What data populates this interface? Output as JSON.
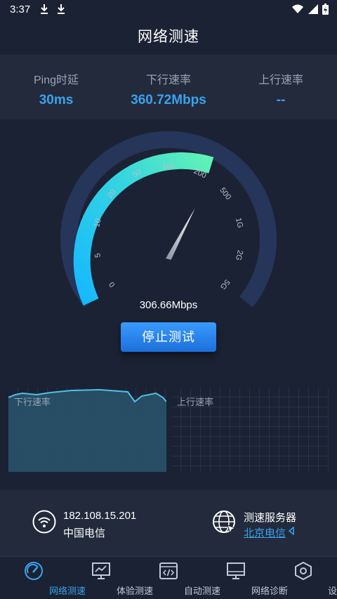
{
  "status_bar": {
    "time": "3:37"
  },
  "header": {
    "title": "网络测速"
  },
  "metrics": [
    {
      "label": "Ping时延",
      "value": "30ms"
    },
    {
      "label": "下行速率",
      "value": "360.72Mbps"
    },
    {
      "label": "上行速率",
      "value": "--"
    }
  ],
  "gauge": {
    "scale_labels": [
      "0",
      "5",
      "10",
      "20",
      "50",
      "100",
      "200",
      "500",
      "1G",
      "2G",
      "5G"
    ],
    "current_speed": "306.66Mbps"
  },
  "actions": {
    "stop_label": "停止测试"
  },
  "graphs": {
    "down_label": "下行速率",
    "up_label": "上行速率"
  },
  "network": {
    "ip": "182.108.15.201",
    "isp": "中国电信"
  },
  "server": {
    "title": "测速服务器",
    "name": "北京电信"
  },
  "nav": {
    "items": [
      {
        "label": "网络测速",
        "icon": "speedometer-icon",
        "active": true
      },
      {
        "label": "体验测速",
        "icon": "monitor-chart-icon"
      },
      {
        "label": "自动测速",
        "icon": "code-window-icon"
      },
      {
        "label": "网络诊断",
        "icon": "monitor-icon"
      },
      {
        "label": "设置",
        "icon": "hexagon-settings-icon"
      }
    ]
  },
  "colors": {
    "accent": "#3aa2ec",
    "background": "#1b2233",
    "panel": "#222a3b",
    "gauge_start": "#18c6ff",
    "gauge_end": "#5ef0b6",
    "gauge_track": "#26355a"
  }
}
